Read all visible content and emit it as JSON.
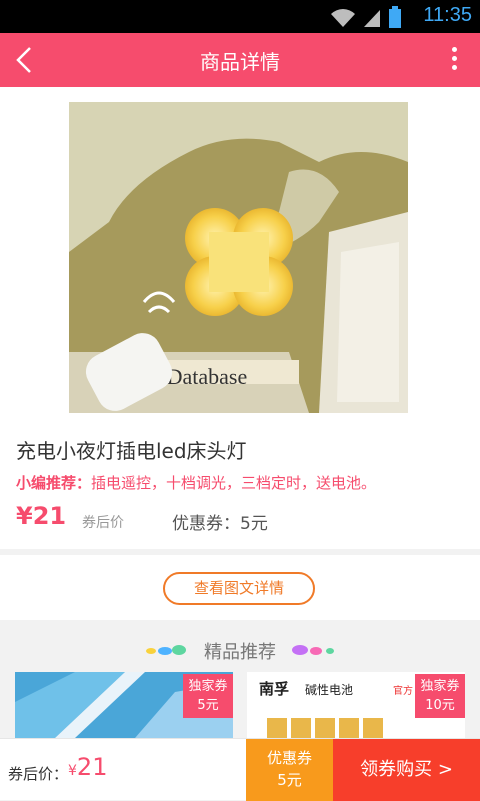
{
  "status_bar": {
    "time": "11:35"
  },
  "nav": {
    "title": "商品详情",
    "back_icon": "chevron-left-icon",
    "more_icon": "more-vertical-icon"
  },
  "product": {
    "image_text": "ss Database",
    "title": "充电小夜灯插电led床头灯",
    "recommend_label": "小编推荐：",
    "recommend_text": "插电遥控，十档调光，三档定时，送电池。",
    "price": "¥21",
    "price_suffix": "券后价",
    "coupon": "优惠券：5元"
  },
  "detail_button": {
    "label": "查看图文详情"
  },
  "recommendations": {
    "title": "精品推荐",
    "items": [
      {
        "badge_line1": "独家券",
        "badge_line2": "5元"
      },
      {
        "badge_line1": "独家券",
        "badge_line2": "10元",
        "image_brand": "南孚",
        "image_product": "碱性电池",
        "image_tag": "官方"
      }
    ]
  },
  "bottom_bar": {
    "price_label": "券后价：",
    "currency": "¥",
    "price_value": "21",
    "coupon_line1": "优惠券",
    "coupon_line2": "5元",
    "buy_label": "领券购买 >"
  },
  "colors": {
    "brand": "#f64c6d",
    "accent_orange": "#f07a28",
    "coupon_bg": "#f89a1c",
    "buy_bg": "#f73e2b"
  }
}
